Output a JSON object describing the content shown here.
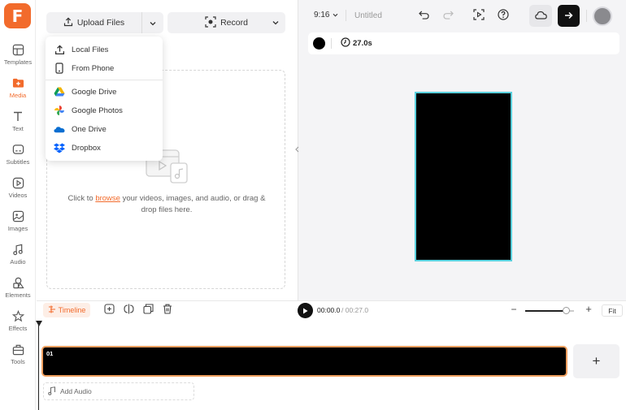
{
  "sidebar": {
    "logo": "F",
    "items": [
      {
        "label": "Templates",
        "icon": "templates-icon"
      },
      {
        "label": "Media",
        "icon": "media-icon",
        "active": true
      },
      {
        "label": "Text",
        "icon": "text-icon"
      },
      {
        "label": "Subtitles",
        "icon": "subtitles-icon"
      },
      {
        "label": "Videos",
        "icon": "videos-icon"
      },
      {
        "label": "Images",
        "icon": "images-icon"
      },
      {
        "label": "Audio",
        "icon": "audio-icon"
      },
      {
        "label": "Elements",
        "icon": "elements-icon"
      },
      {
        "label": "Effects",
        "icon": "effects-icon"
      },
      {
        "label": "Tools",
        "icon": "tools-icon"
      }
    ]
  },
  "media_panel": {
    "upload_label": "Upload Files",
    "record_label": "Record",
    "dropzone": {
      "prefix": "Click to ",
      "link": "browse",
      "suffix": " your videos, images, and audio, or drag & drop files here."
    }
  },
  "upload_menu": {
    "items": [
      {
        "label": "Local Files",
        "icon": "upload-icon"
      },
      {
        "label": "From Phone",
        "icon": "phone-icon"
      },
      {
        "label": "Google Drive",
        "icon": "google-drive-icon"
      },
      {
        "label": "Google Photos",
        "icon": "google-photos-icon"
      },
      {
        "label": "One Drive",
        "icon": "onedrive-icon"
      },
      {
        "label": "Dropbox",
        "icon": "dropbox-icon"
      }
    ]
  },
  "topbar": {
    "aspect_ratio": "9:16",
    "project_title": "Untitled"
  },
  "properties": {
    "background_color": "#000000",
    "duration": "27.0s"
  },
  "canvas": {
    "fill_color": "#000000",
    "selection_color": "#5ad0dd"
  },
  "timeline": {
    "tab_label": "Timeline",
    "current_time": "00:00.0",
    "total_time": "/ 00:27.0",
    "zoom_level": 0.85,
    "fit_label": "Fit",
    "clip_label": "01",
    "add_track_label": "+",
    "add_audio_label": "Add Audio"
  },
  "colors": {
    "accent": "#f26b2c",
    "clip_border": "#f0a060"
  }
}
